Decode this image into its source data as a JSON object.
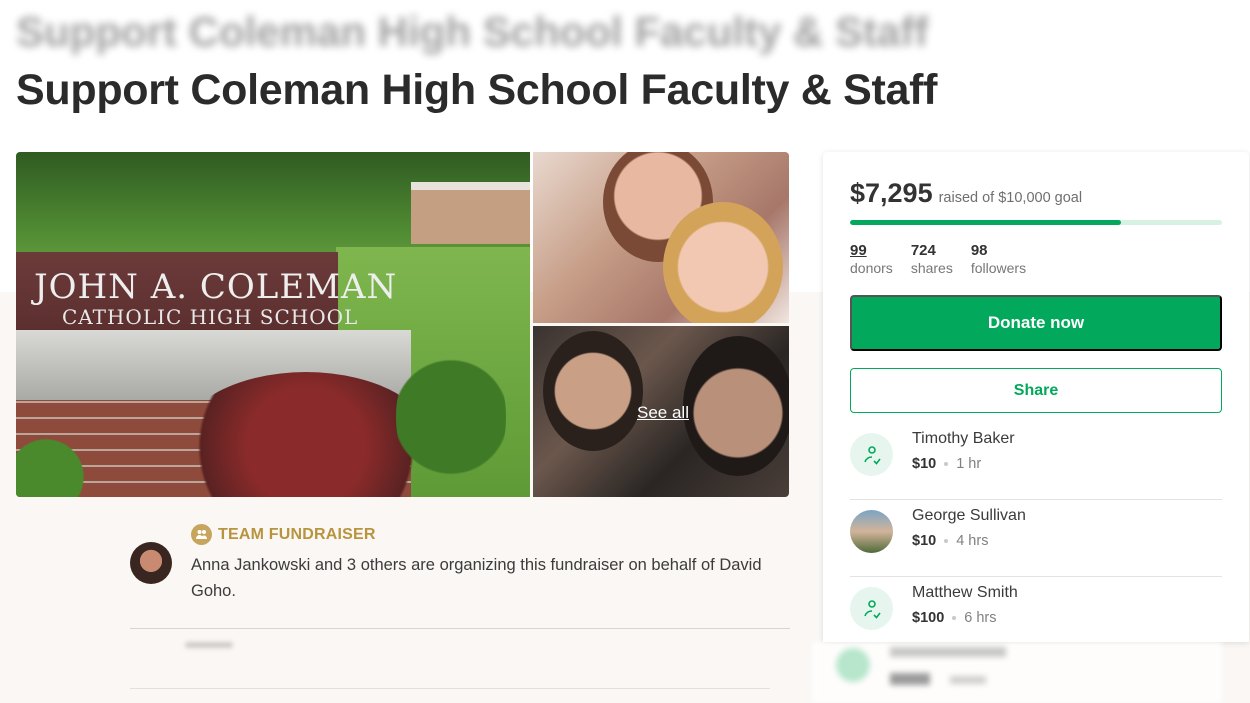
{
  "page": {
    "title_blurred": "Support Coleman High School Faculty & Staff",
    "title": "Support Coleman High School Faculty & Staff"
  },
  "gallery": {
    "sign_line1": "JOHN A. COLEMAN",
    "sign_line2": "CATHOLIC HIGH SCHOOL",
    "see_all": "See all"
  },
  "organizer": {
    "badge": "TEAM FUNDRAISER",
    "description": "Anna Jankowski and 3 others are organizing this fundraiser on behalf of David Goho."
  },
  "donation_panel": {
    "raised_amount": "$7,295",
    "raised_text": "raised of $10,000 goal",
    "progress_fraction": 0.7295,
    "stats": [
      {
        "num": "99",
        "label": "donors"
      },
      {
        "num": "724",
        "label": "shares"
      },
      {
        "num": "98",
        "label": "followers"
      }
    ],
    "donate_label": "Donate now",
    "share_label": "Share",
    "donors": [
      {
        "name": "Timothy Baker",
        "amount": "$10",
        "time": "1 hr",
        "avatar": "heart-hand-icon"
      },
      {
        "name": "George Sullivan",
        "amount": "$10",
        "time": "4 hrs",
        "avatar": "photo"
      },
      {
        "name": "Matthew Smith",
        "amount": "$100",
        "time": "6 hrs",
        "avatar": "heart-hand-icon"
      }
    ]
  },
  "colors": {
    "accent_green": "#02a95c",
    "team_gold": "#b8943f"
  }
}
